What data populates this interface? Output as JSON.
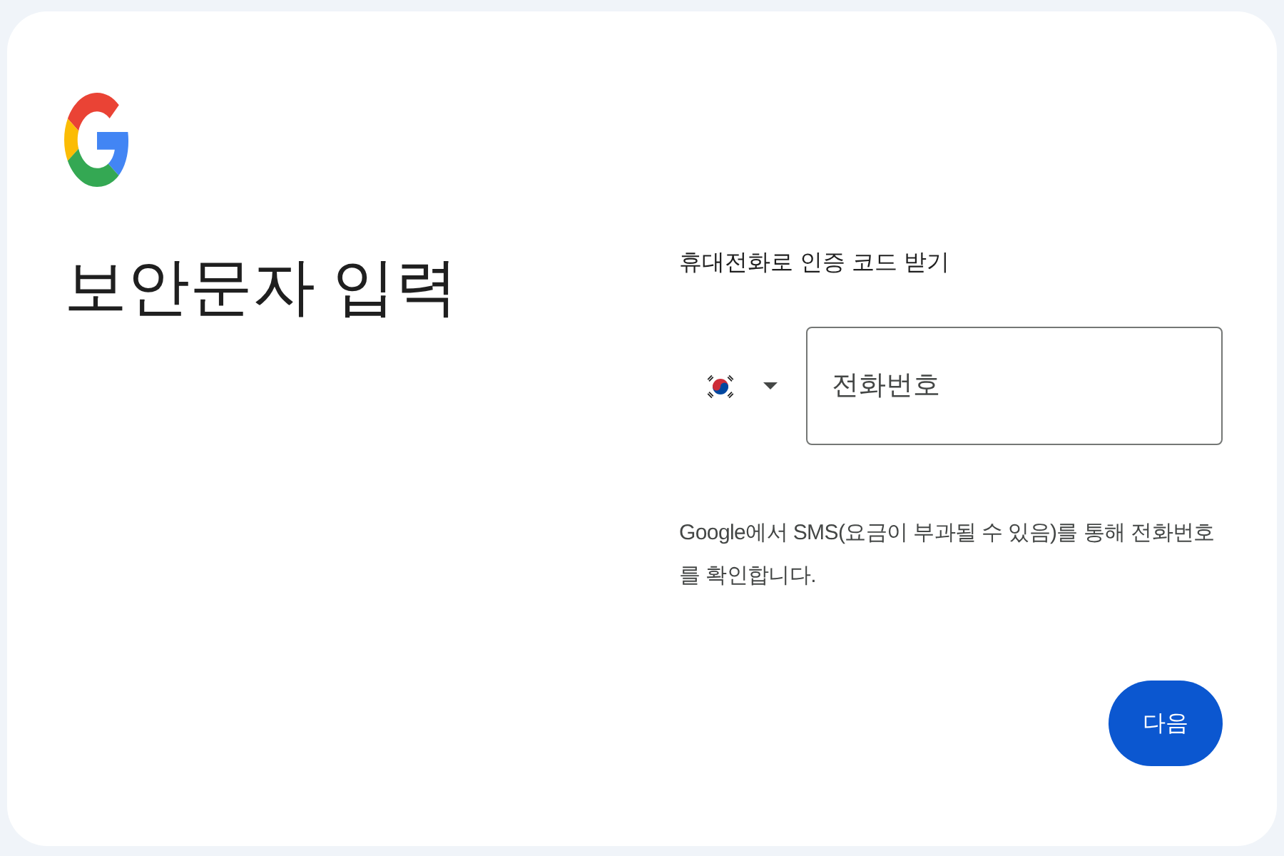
{
  "heading": "보안문자 입력",
  "phone_section": {
    "label": "휴대전화로 인증 코드 받기",
    "phone_field": {
      "placeholder": "전화번호"
    }
  },
  "notice": "Google에서 SMS(요금이 부과될 수 있음)를 통해 전화번호를 확인합니다.",
  "buttons": [
    {
      "label": "다음"
    }
  ]
}
